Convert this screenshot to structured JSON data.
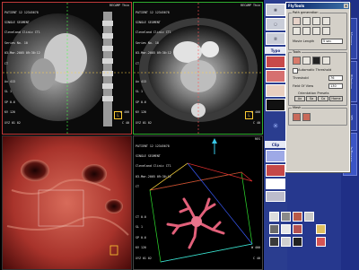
{
  "viewports": {
    "top_left": {
      "patient_lines": [
        "PATIENT 12 12345678",
        "SINGLE SEGMENT",
        "Cleveland Clinic CT1",
        "Series No. 10",
        "03-Mar-2005 09:30:12",
        "CT"
      ],
      "corner_tr": "RECAMP Thin",
      "corner_bl": [
        "Ax 413",
        "SL 1",
        "SP 0.6",
        "KV 120",
        "XYZ 01 02"
      ],
      "corner_br": [
        "W 400",
        "C 40"
      ],
      "badge": "L"
    },
    "top_right": {
      "patient_lines": [
        "PATIENT 12 12345678",
        "SINGLE SEGMENT",
        "Cleveland Clinic CT1",
        "Series No. 10",
        "03-Mar-2005 09:30:12",
        "CT"
      ],
      "corner_tr": "RECAMP Thin",
      "corner_bl": [
        "Ax 413",
        "SL 1",
        "SP 0.6",
        "KV 120",
        "XYZ 01 02"
      ],
      "corner_br": [
        "W 400",
        "C 40"
      ],
      "badge": "L"
    },
    "bottom_right": {
      "patient_lines": [
        "PATIENT 12 12345678",
        "SINGLE SEGMENT",
        "Cleveland Clinic CT1",
        "03-Mar-2005 09:30:12",
        "CT"
      ],
      "corner_tr": "RES",
      "corner_bl": [
        "CT 0.0",
        "SL 1",
        "SP 0.6",
        "KV 120",
        "XYZ 01 02"
      ],
      "corner_br": [
        "W 400",
        "C 40"
      ]
    }
  },
  "tool_column": {
    "labels": [
      "Typo",
      "Clip"
    ]
  },
  "vertical_tabs": [
    "Viewer",
    "Filming",
    "3D",
    "InSpace"
  ],
  "flytools": {
    "title": "FlyTools",
    "path_generation": "Path generation",
    "movie_length_label": "Movie Length",
    "movie_length_value": "5 sec",
    "tools": "Tools",
    "auto_threshold": "Automatic Threshold",
    "threshold_label": "Threshold",
    "threshold_value": "76",
    "fov_label": "Field Of View",
    "fov_value": "130",
    "orientation_presets": "Orientation Presets",
    "preset_buttons": [
      "Ax",
      "Sa",
      "Co",
      "Home"
    ],
    "mesh": "Mesh"
  },
  "colors": {
    "active_border": "#c23a3a",
    "secondary_border": "#2fae2f",
    "panel_blue": "#2a3d8f",
    "window_gray": "#d4d0c8"
  }
}
